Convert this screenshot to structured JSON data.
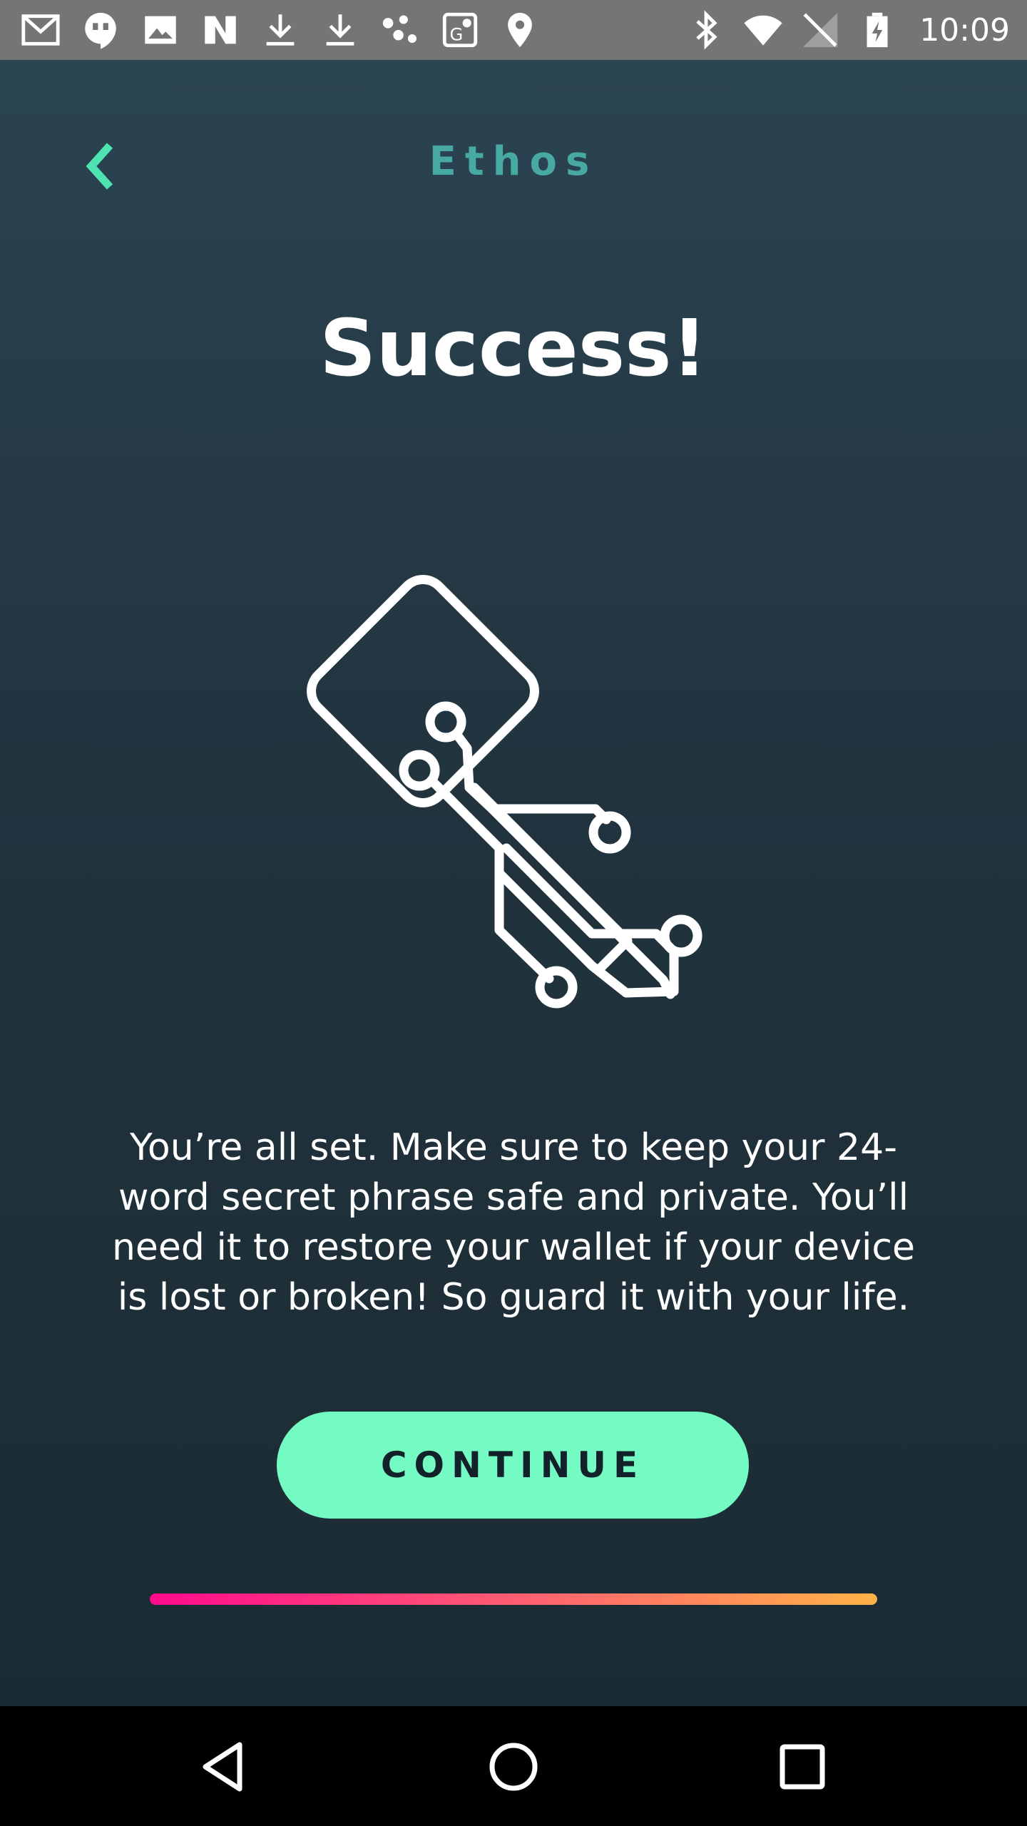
{
  "status_bar": {
    "time": "10:09",
    "left_icons": [
      "gmail-icon",
      "hangouts-icon",
      "image-icon",
      "news-icon",
      "download-icon",
      "download-icon",
      "dots-icon",
      "maps-icon",
      "location-icon"
    ],
    "right_icons": [
      "bluetooth-icon",
      "wifi-icon",
      "no-signal-icon",
      "battery-charging-icon"
    ]
  },
  "header": {
    "brand": "Ethos",
    "back_icon": "chevron-left-icon"
  },
  "main": {
    "title": "Success!",
    "illustration": "circuit-key-icon",
    "message": "You’re all set. Make sure to keep your 24-word secret phrase safe and private. You’ll need it to restore your wallet if your device is lost or broken! So guard it with your life.",
    "continue_label": "CONTINUE",
    "progress": 1.0
  },
  "nav_bar": {
    "items": [
      "back-triangle-icon",
      "home-circle-icon",
      "recents-square-icon"
    ]
  },
  "colors": {
    "accent": "#74fbc3",
    "brand": "#48a9a0",
    "background_top": "#2b4452",
    "background_bottom": "#1b2b33",
    "progress_start": "#ff0a8c",
    "progress_end": "#ffb347"
  }
}
